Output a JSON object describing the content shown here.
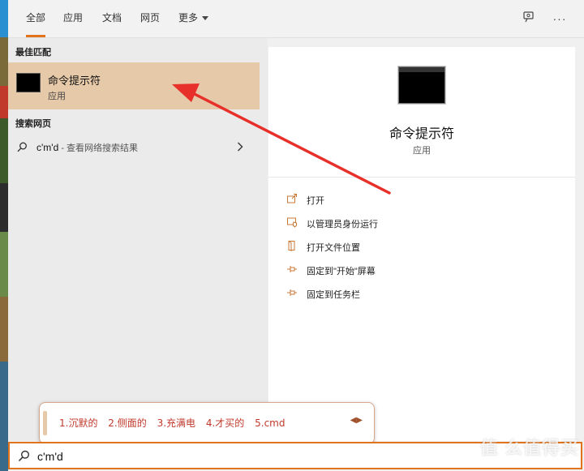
{
  "tabs": [
    {
      "label": "全部",
      "active": true
    },
    {
      "label": "应用",
      "active": false
    },
    {
      "label": "文档",
      "active": false
    },
    {
      "label": "网页",
      "active": false
    },
    {
      "label": "更多",
      "active": false
    }
  ],
  "header_icons": [
    "feedback-icon",
    "more-options-icon"
  ],
  "left_panel": {
    "best_match_header": "最佳匹配",
    "best_match": {
      "title": "命令提示符",
      "subtitle": "应用",
      "icon": "cmd-icon"
    },
    "web_header": "搜索网页",
    "web_result": {
      "query": "c'm'd",
      "suffix": " - 查看网络搜索结果"
    }
  },
  "detail": {
    "title": "命令提示符",
    "subtitle": "应用",
    "actions": [
      {
        "label": "打开",
        "icon": "open-icon"
      },
      {
        "label": "以管理员身份运行",
        "icon": "admin-shield-icon"
      },
      {
        "label": "打开文件位置",
        "icon": "folder-icon"
      },
      {
        "label": "固定到\"开始\"屏幕",
        "icon": "pin-icon"
      },
      {
        "label": "固定到任务栏",
        "icon": "pin-icon"
      }
    ]
  },
  "ime": {
    "candidates": [
      "1.沉默的",
      "2.侧面的",
      "3.充满电",
      "4.才买的",
      "5.cmd"
    ],
    "nav": "◀▶"
  },
  "search": {
    "value": "c'm'd"
  },
  "watermark": "值 么值得买",
  "colors": {
    "accent": "#e0731b",
    "highlight": "#e6c9a8",
    "arrow": "#e8302a"
  }
}
